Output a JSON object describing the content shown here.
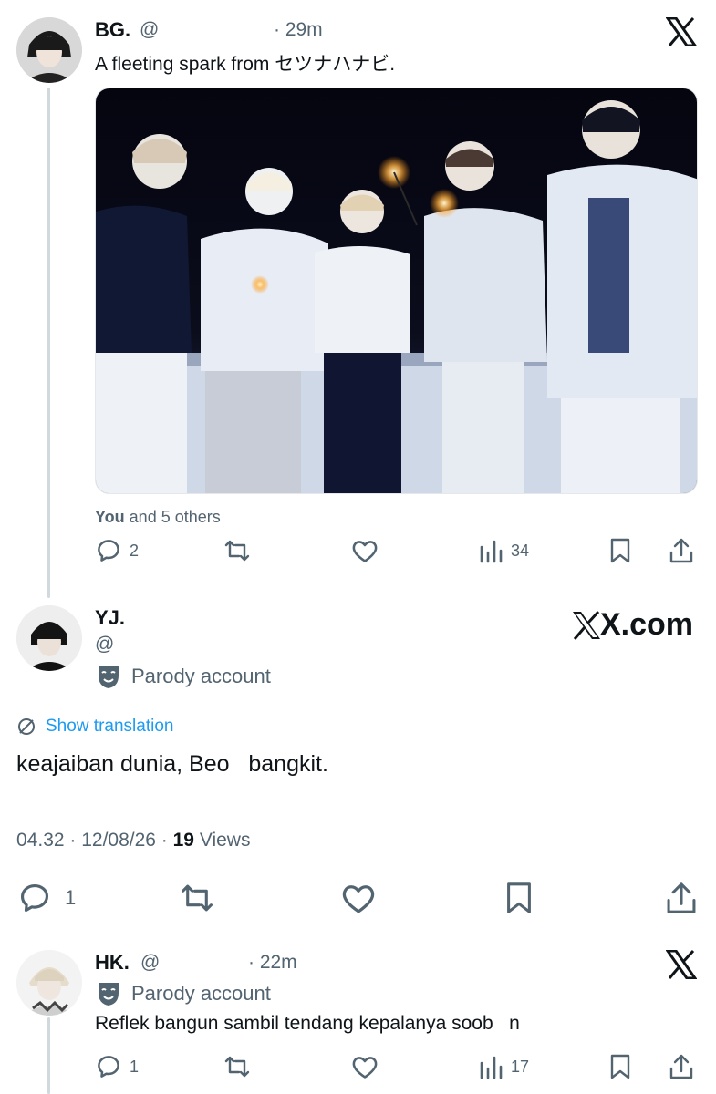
{
  "post1": {
    "author": "BG.",
    "handle": "@",
    "time": "· 29m",
    "text": "A fleeting spark from セツナハナビ.",
    "likes_line": {
      "you": "You",
      "rest": " and 5 others"
    },
    "replies": "2",
    "views": "34"
  },
  "post2": {
    "author": "YJ.",
    "handle": "@",
    "badge": "Parody account",
    "translate": "Show translation",
    "text": "keajaiban dunia, Beo   bangkit.",
    "meta": {
      "datetime": "04.32 · 12/08/26 · ",
      "views": "19",
      "views_label": " Views"
    },
    "replies": "1",
    "watermark": "X.com"
  },
  "post3": {
    "author": "HK.",
    "handle": "@",
    "time": "· 22m",
    "badge": "Parody account",
    "text": "Reflek bangun sambil tendang kepalanya soob   n",
    "replies": "1",
    "views": "17"
  },
  "colors": {
    "text": "#0f1419",
    "secondary": "#536471",
    "link": "#1d9bf0",
    "line": "#cfd9de"
  },
  "icons": [
    "x-logo",
    "reply-icon",
    "repost-icon",
    "like-icon",
    "views-icon",
    "bookmark-icon",
    "share-icon",
    "parody-mask-icon",
    "translate-icon"
  ]
}
